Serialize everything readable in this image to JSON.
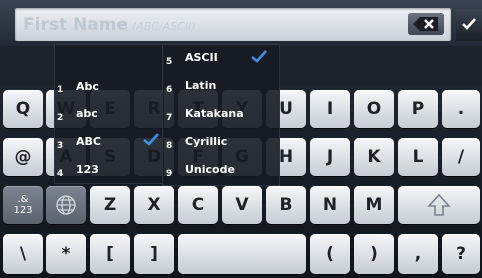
{
  "field": {
    "label": "First Name",
    "hint": "(ABC/ASCII)"
  },
  "icons": {
    "backspace": "backspace-icon",
    "done": "checkmark-icon",
    "globe": "globe-icon",
    "shift": "shift-arrow-icon"
  },
  "popup_left": [
    {
      "num": "1",
      "label": "Abc",
      "selected": false
    },
    {
      "num": "2",
      "label": "abc",
      "selected": false
    },
    {
      "num": "3",
      "label": "ABC",
      "selected": true
    },
    {
      "num": "4",
      "label": "123",
      "selected": false
    }
  ],
  "popup_right": [
    {
      "num": "5",
      "label": "ASCII",
      "selected": true
    },
    {
      "num": "6",
      "label": "Latin",
      "selected": false
    },
    {
      "num": "7",
      "label": "Katakana",
      "selected": false
    },
    {
      "num": "8",
      "label": "Cyrillic",
      "selected": false
    },
    {
      "num": "9",
      "label": "Unicode",
      "selected": false
    }
  ],
  "keys": {
    "row1": [
      "Q",
      "W",
      "E",
      "R",
      "T",
      "Y",
      "U",
      "I",
      "O",
      "P",
      "."
    ],
    "row2": [
      "@",
      "A",
      "S",
      "D",
      "F",
      "G",
      "H",
      "J",
      "K",
      "L",
      "/"
    ],
    "row3_mode": ".&\n123",
    "row3": [
      "Z",
      "X",
      "C",
      "V",
      "B",
      "N",
      "M"
    ],
    "row4": [
      "\\",
      "*",
      "[",
      "]",
      "(",
      ")",
      ",",
      "?"
    ]
  },
  "colors": {
    "check": "#3f8fe6",
    "key_light": "#e6eaee",
    "key_dark": "#6b7480"
  }
}
